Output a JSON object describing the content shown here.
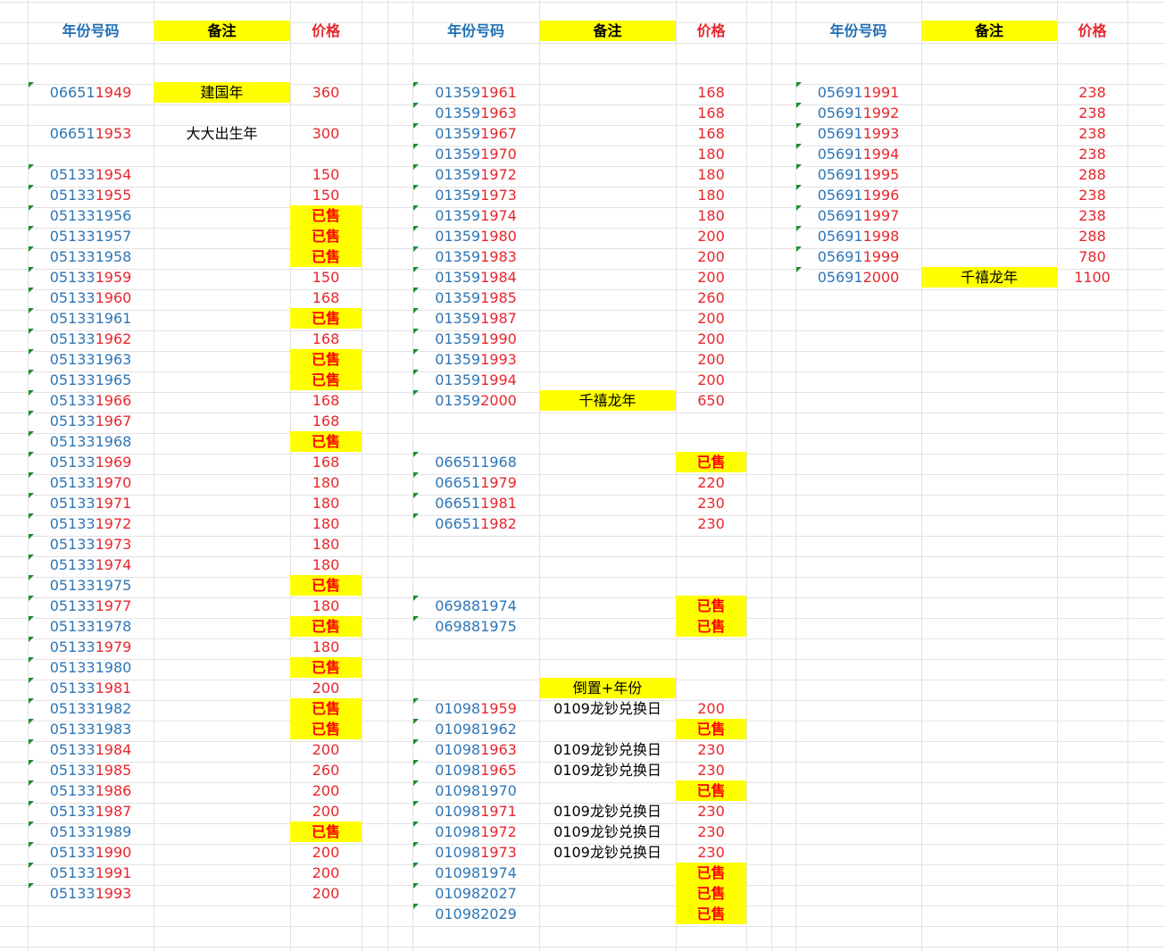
{
  "headers": {
    "code": "年份号码",
    "note": "备注",
    "price": "价格"
  },
  "blocks": [
    {
      "rows": [
        {
          "r": 3,
          "pre": "06651",
          "suf": "1949",
          "note": "建国年",
          "noteHl": true,
          "price": "360"
        },
        {
          "r": 5,
          "pre": "06651",
          "suf": "1953",
          "note": "大大出生年",
          "price": "300",
          "noTri": true
        },
        {
          "r": 7,
          "pre": "05133",
          "suf": "1954",
          "price": "150"
        },
        {
          "r": 8,
          "pre": "05133",
          "suf": "1955",
          "price": "150"
        },
        {
          "r": 9,
          "pre": "051331956",
          "suf": "",
          "price": "已售",
          "sold": true
        },
        {
          "r": 10,
          "pre": "051331957",
          "suf": "",
          "price": "已售",
          "sold": true
        },
        {
          "r": 11,
          "pre": "051331958",
          "suf": "",
          "price": "已售",
          "sold": true
        },
        {
          "r": 12,
          "pre": "05133",
          "suf": "1959",
          "price": "150"
        },
        {
          "r": 13,
          "pre": "05133",
          "suf": "1960",
          "price": "168"
        },
        {
          "r": 14,
          "pre": "051331961",
          "suf": "",
          "price": "已售",
          "sold": true
        },
        {
          "r": 15,
          "pre": "05133",
          "suf": "1962",
          "price": "168"
        },
        {
          "r": 16,
          "pre": "051331963",
          "suf": "",
          "price": "已售",
          "sold": true
        },
        {
          "r": 17,
          "pre": "051331965",
          "suf": "",
          "price": "已售",
          "sold": true
        },
        {
          "r": 18,
          "pre": "05133",
          "suf": "1966",
          "price": "168"
        },
        {
          "r": 19,
          "pre": "05133",
          "suf": "1967",
          "price": "168"
        },
        {
          "r": 20,
          "pre": "051331968",
          "suf": "",
          "price": "已售",
          "sold": true
        },
        {
          "r": 21,
          "pre": "05133",
          "suf": "1969",
          "price": "168"
        },
        {
          "r": 22,
          "pre": "05133",
          "suf": "1970",
          "price": "180"
        },
        {
          "r": 23,
          "pre": "05133",
          "suf": "1971",
          "price": "180"
        },
        {
          "r": 24,
          "pre": "05133",
          "suf": "1972",
          "price": "180"
        },
        {
          "r": 25,
          "pre": "05133",
          "suf": "1973",
          "price": "180"
        },
        {
          "r": 26,
          "pre": "05133",
          "suf": "1974",
          "price": "180"
        },
        {
          "r": 27,
          "pre": "051331975",
          "suf": "",
          "price": "已售",
          "sold": true
        },
        {
          "r": 28,
          "pre": "05133",
          "suf": "1977",
          "price": "180"
        },
        {
          "r": 29,
          "pre": "051331978",
          "suf": "",
          "price": "已售",
          "sold": true
        },
        {
          "r": 30,
          "pre": "05133",
          "suf": "1979",
          "price": "180"
        },
        {
          "r": 31,
          "pre": "051331980",
          "suf": "",
          "price": "已售",
          "sold": true
        },
        {
          "r": 32,
          "pre": "05133",
          "suf": "1981",
          "price": "200"
        },
        {
          "r": 33,
          "pre": "051331982",
          "suf": "",
          "price": "已售",
          "sold": true
        },
        {
          "r": 34,
          "pre": "051331983",
          "suf": "",
          "price": "已售",
          "sold": true
        },
        {
          "r": 35,
          "pre": "05133",
          "suf": "1984",
          "price": "200"
        },
        {
          "r": 36,
          "pre": "05133",
          "suf": "1985",
          "price": "260"
        },
        {
          "r": 37,
          "pre": "05133",
          "suf": "1986",
          "price": "200"
        },
        {
          "r": 38,
          "pre": "05133",
          "suf": "1987",
          "price": "200"
        },
        {
          "r": 39,
          "pre": "051331989",
          "suf": "",
          "price": "已售",
          "sold": true
        },
        {
          "r": 40,
          "pre": "05133",
          "suf": "1990",
          "price": "200"
        },
        {
          "r": 41,
          "pre": "05133",
          "suf": "1991",
          "price": "200"
        },
        {
          "r": 42,
          "pre": "05133",
          "suf": "1993",
          "price": "200"
        }
      ]
    },
    {
      "rows": [
        {
          "r": 3,
          "pre": "01359",
          "suf": "1961",
          "price": "168"
        },
        {
          "r": 4,
          "pre": "01359",
          "suf": "1963",
          "price": "168"
        },
        {
          "r": 5,
          "pre": "01359",
          "suf": "1967",
          "price": "168"
        },
        {
          "r": 6,
          "pre": "01359",
          "suf": "1970",
          "price": "180"
        },
        {
          "r": 7,
          "pre": "01359",
          "suf": "1972",
          "price": "180"
        },
        {
          "r": 8,
          "pre": "01359",
          "suf": "1973",
          "price": "180"
        },
        {
          "r": 9,
          "pre": "01359",
          "suf": "1974",
          "price": "180"
        },
        {
          "r": 10,
          "pre": "01359",
          "suf": "1980",
          "price": "200"
        },
        {
          "r": 11,
          "pre": "01359",
          "suf": "1983",
          "price": "200"
        },
        {
          "r": 12,
          "pre": "01359",
          "suf": "1984",
          "price": "200"
        },
        {
          "r": 13,
          "pre": "01359",
          "suf": "1985",
          "price": "260"
        },
        {
          "r": 14,
          "pre": "01359",
          "suf": "1987",
          "price": "200"
        },
        {
          "r": 15,
          "pre": "01359",
          "suf": "1990",
          "price": "200"
        },
        {
          "r": 16,
          "pre": "01359",
          "suf": "1993",
          "price": "200"
        },
        {
          "r": 17,
          "pre": "01359",
          "suf": "1994",
          "price": "200"
        },
        {
          "r": 18,
          "pre": "01359",
          "suf": "2000",
          "note": "千禧龙年",
          "noteHl": true,
          "price": "650"
        },
        {
          "r": 21,
          "pre": "066511968",
          "suf": "",
          "price": "已售",
          "sold": true
        },
        {
          "r": 22,
          "pre": "06651",
          "suf": "1979",
          "price": "220"
        },
        {
          "r": 23,
          "pre": "06651",
          "suf": "1981",
          "price": "230"
        },
        {
          "r": 24,
          "pre": "06651",
          "suf": "1982",
          "price": "230"
        },
        {
          "r": 28,
          "pre": "069881974",
          "suf": "",
          "price": "已售",
          "sold": true
        },
        {
          "r": 29,
          "pre": "069881975",
          "suf": "",
          "price": "已售",
          "sold": true
        },
        {
          "r": 32,
          "pre": "",
          "suf": "",
          "note": "倒置+年份",
          "noteHl": true,
          "price": "",
          "noTri": true
        },
        {
          "r": 33,
          "pre": "01098",
          "suf": "1959",
          "note": "0109龙钞兑换日",
          "price": "200"
        },
        {
          "r": 34,
          "pre": "010981962",
          "suf": "",
          "price": "已售",
          "sold": true
        },
        {
          "r": 35,
          "pre": "01098",
          "suf": "1963",
          "note": "0109龙钞兑换日",
          "price": "230"
        },
        {
          "r": 36,
          "pre": "01098",
          "suf": "1965",
          "note": "0109龙钞兑换日",
          "price": "230"
        },
        {
          "r": 37,
          "pre": "010981970",
          "suf": "",
          "price": "已售",
          "sold": true
        },
        {
          "r": 38,
          "pre": "01098",
          "suf": "1971",
          "note": "0109龙钞兑换日",
          "price": "230"
        },
        {
          "r": 39,
          "pre": "01098",
          "suf": "1972",
          "note": "0109龙钞兑换日",
          "price": "230"
        },
        {
          "r": 40,
          "pre": "01098",
          "suf": "1973",
          "note": "0109龙钞兑换日",
          "price": "230"
        },
        {
          "r": 41,
          "pre": "010981974",
          "suf": "",
          "price": "已售",
          "sold": true
        },
        {
          "r": 42,
          "pre": "010982027",
          "suf": "",
          "price": "已售",
          "sold": true
        },
        {
          "r": 43,
          "pre": "010982029",
          "suf": "",
          "price": "已售",
          "sold": true
        }
      ]
    },
    {
      "rows": [
        {
          "r": 3,
          "pre": "05691",
          "suf": "1991",
          "price": "238"
        },
        {
          "r": 4,
          "pre": "05691",
          "suf": "1992",
          "price": "238"
        },
        {
          "r": 5,
          "pre": "05691",
          "suf": "1993",
          "price": "238"
        },
        {
          "r": 6,
          "pre": "05691",
          "suf": "1994",
          "price": "238"
        },
        {
          "r": 7,
          "pre": "05691",
          "suf": "1995",
          "price": "288"
        },
        {
          "r": 8,
          "pre": "05691",
          "suf": "1996",
          "price": "238"
        },
        {
          "r": 9,
          "pre": "05691",
          "suf": "1997",
          "price": "238"
        },
        {
          "r": 10,
          "pre": "05691",
          "suf": "1998",
          "price": "288"
        },
        {
          "r": 11,
          "pre": "05691",
          "suf": "1999",
          "price": "780"
        },
        {
          "r": 12,
          "pre": "05691",
          "suf": "2000",
          "note": "千禧龙年",
          "noteHl": true,
          "price": "1100"
        }
      ]
    }
  ]
}
